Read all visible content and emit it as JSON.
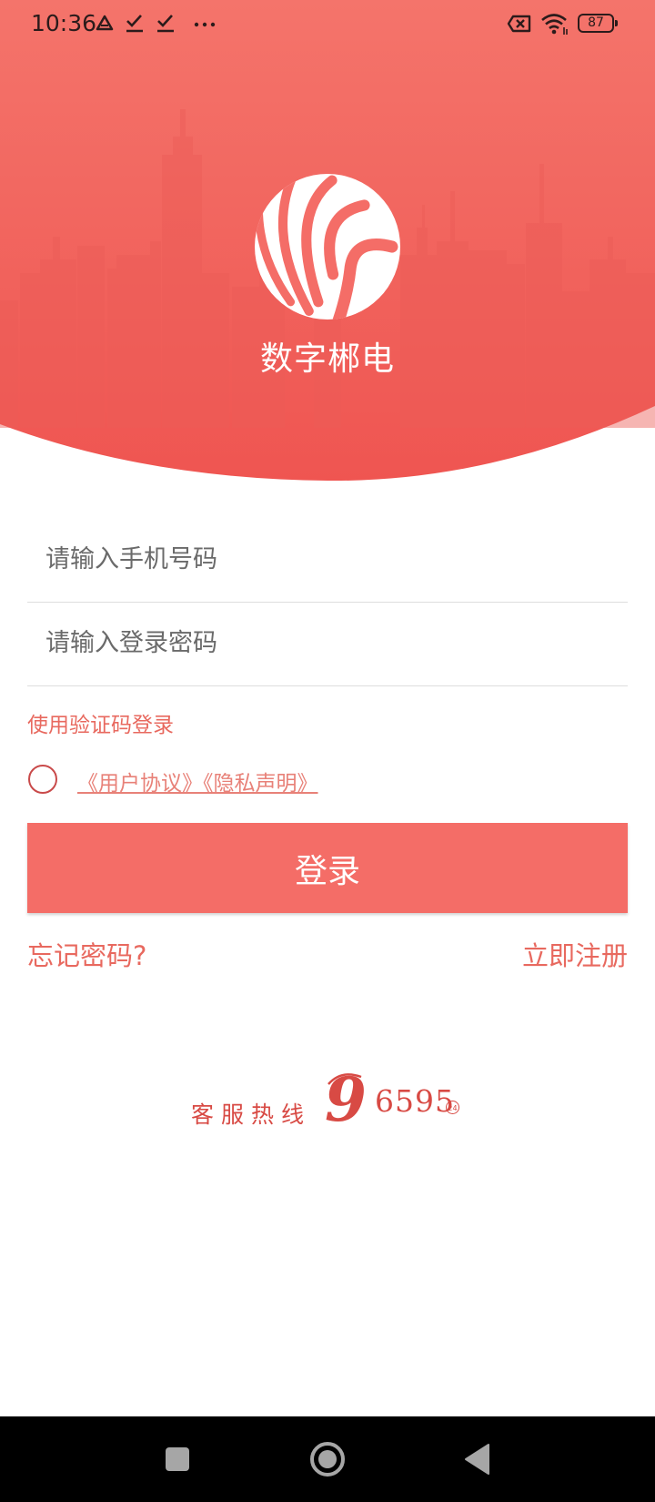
{
  "status_bar": {
    "time": "10:36",
    "battery": "87",
    "icons": [
      "drive-icon",
      "check-icon",
      "check-icon",
      "more-dots-icon",
      "battery-saver-icon",
      "wifi-icon",
      "battery-icon"
    ]
  },
  "header": {
    "app_name": "数字郴电",
    "logo": "app-logo",
    "background_color": "#f46d67"
  },
  "form": {
    "phone_placeholder": "请输入手机号码",
    "password_placeholder": "请输入登录密码",
    "sms_login_label": "使用验证码登录",
    "agreement_links": "《用户协议》《隐私声明》",
    "login_label": "登录",
    "forgot_label": "忘记密码?",
    "register_label": "立即注册"
  },
  "hotline": {
    "label": "客服热线",
    "number_lead": "9",
    "number_rest": "6595",
    "badge": "24"
  },
  "nav_bar": {
    "icons": [
      "recents-square-icon",
      "home-circle-icon",
      "back-triangle-icon"
    ]
  },
  "colors": {
    "accent": "#f46d67",
    "link": "#e8695f",
    "hotline": "#d84a44"
  }
}
